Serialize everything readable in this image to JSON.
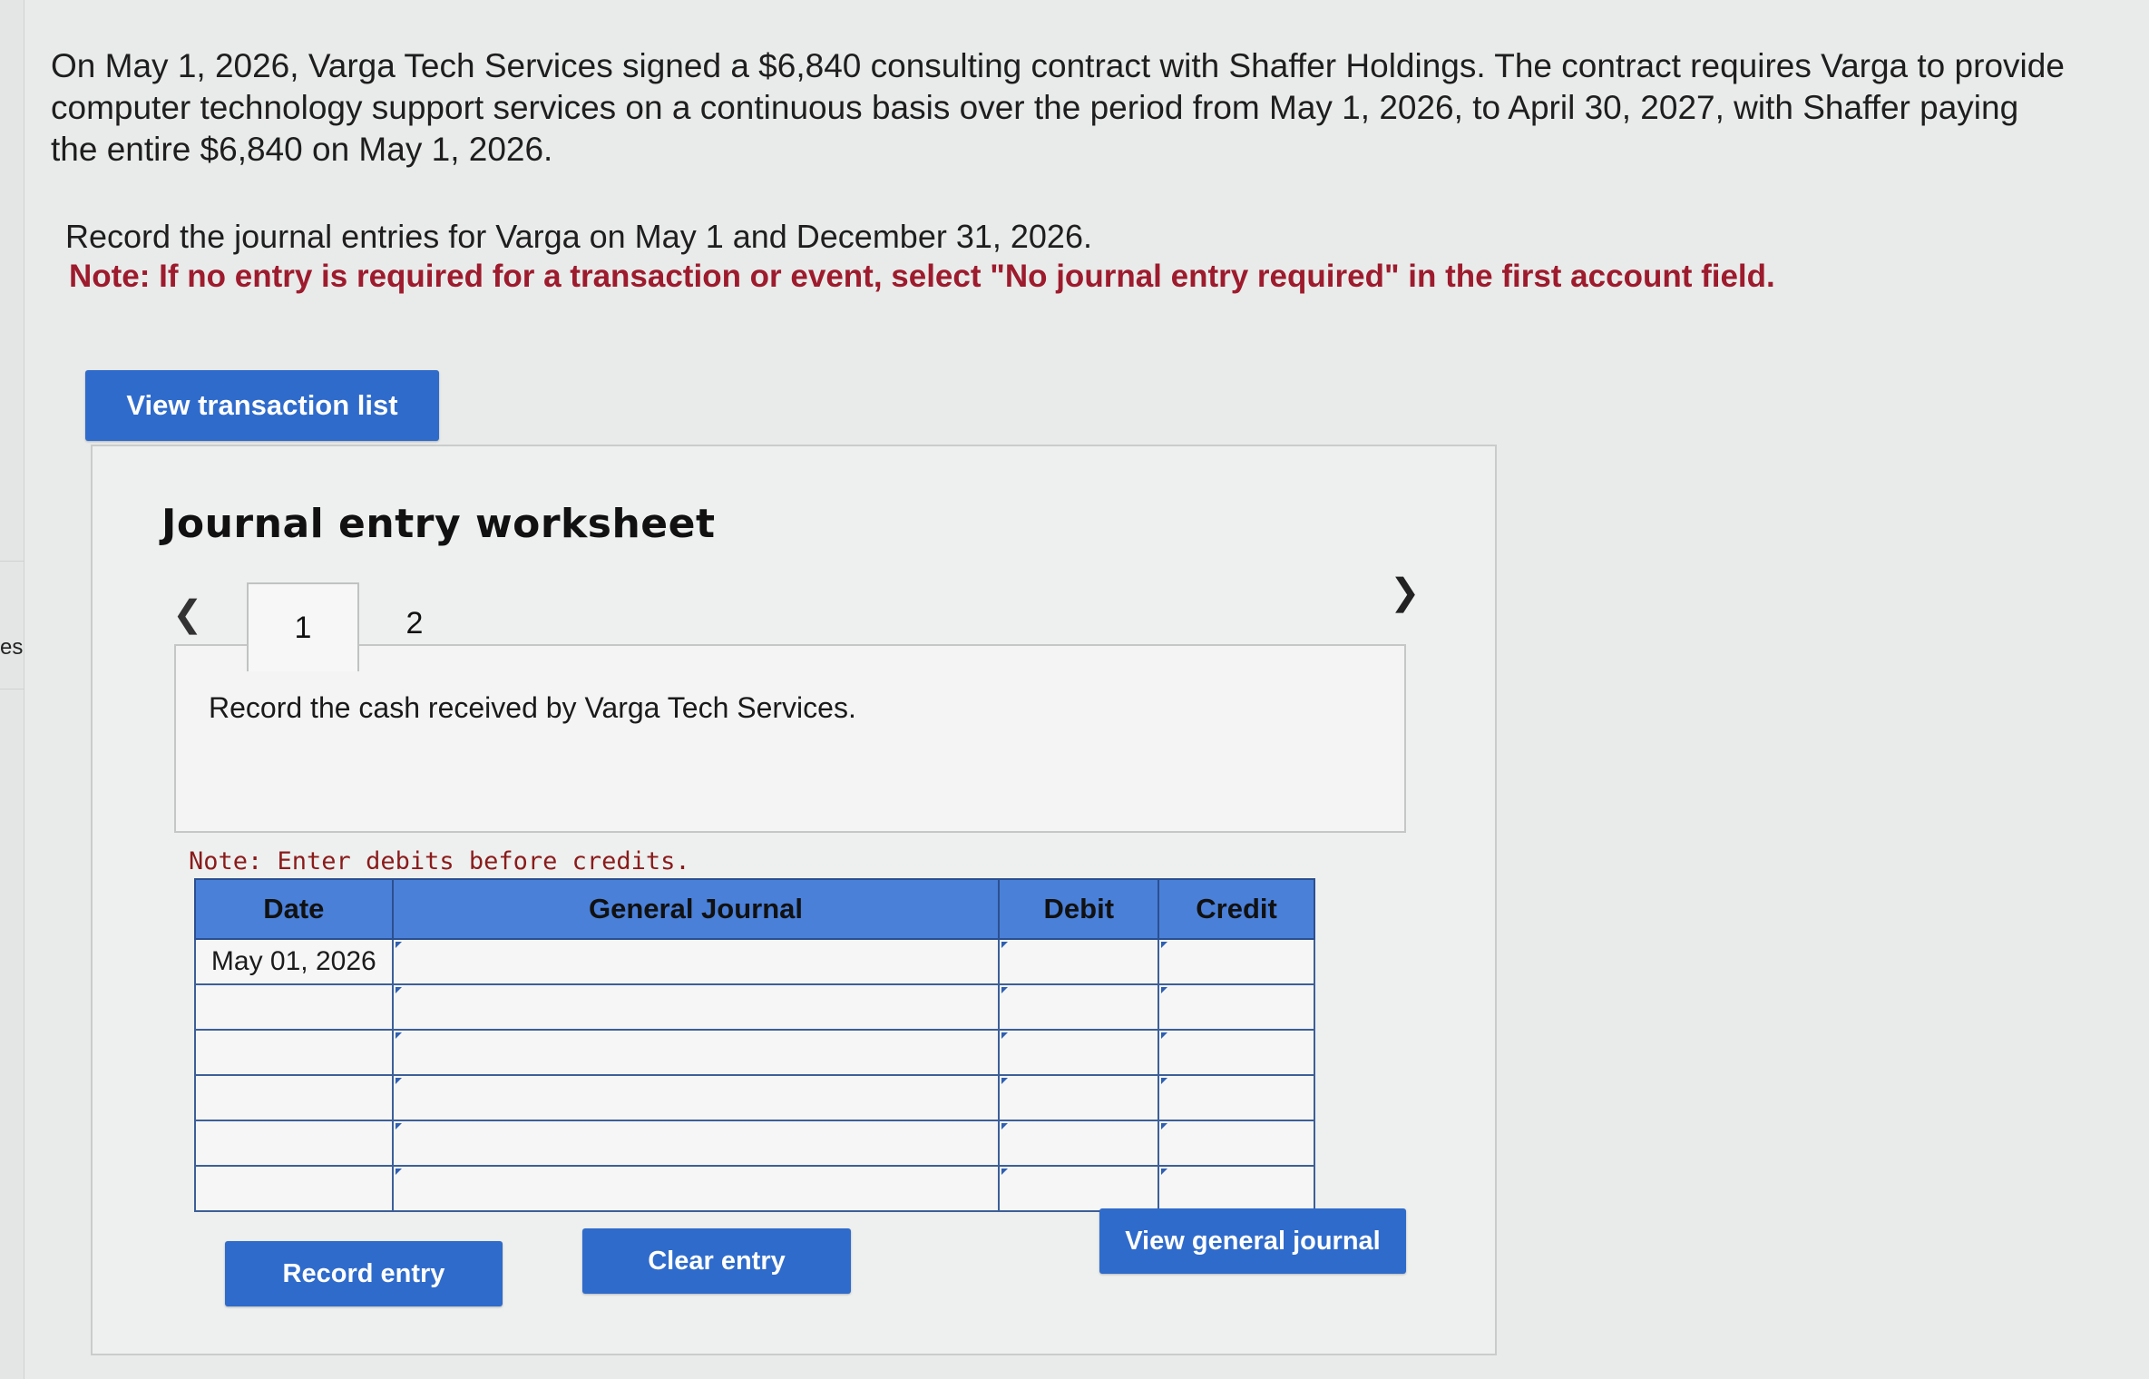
{
  "problem": {
    "intro": "On May 1, 2026, Varga Tech Services signed a $6,840 consulting contract with Shaffer Holdings. The contract requires Varga to provide computer technology support services on a continuous basis over the period from May 1, 2026, to April 30, 2027, with Shaffer paying the entire $6,840 on May 1, 2026.",
    "instruction": "Record the journal entries for Varga on May 1 and December 31, 2026.",
    "note": "Note: If no entry is required for a transaction or event, select \"No journal entry required\" in the first account field."
  },
  "left_rail": {
    "fragment": "es"
  },
  "buttons": {
    "view_transaction_list": "View transaction list",
    "record_entry": "Record entry",
    "clear_entry": "Clear entry",
    "view_general_journal": "View general journal"
  },
  "worksheet": {
    "title": "Journal entry worksheet",
    "tabs": [
      {
        "label": "1",
        "active": true
      },
      {
        "label": "2",
        "active": false
      }
    ],
    "prompt": "Record the cash received by Varga Tech Services.",
    "note": "Note: Enter debits before credits.",
    "columns": {
      "date": "Date",
      "general_journal": "General Journal",
      "debit": "Debit",
      "credit": "Credit"
    },
    "rows": [
      {
        "date": "May 01, 2026",
        "account": "",
        "debit": "",
        "credit": ""
      },
      {
        "date": "",
        "account": "",
        "debit": "",
        "credit": ""
      },
      {
        "date": "",
        "account": "",
        "debit": "",
        "credit": ""
      },
      {
        "date": "",
        "account": "",
        "debit": "",
        "credit": ""
      },
      {
        "date": "",
        "account": "",
        "debit": "",
        "credit": ""
      },
      {
        "date": "",
        "account": "",
        "debit": "",
        "credit": ""
      }
    ]
  },
  "icons": {
    "prev": "chevron-left-icon",
    "next": "chevron-right-icon"
  },
  "colors": {
    "button_blue": "#2f6bcb",
    "header_blue": "#4a80d8",
    "note_red": "#9d1b2d"
  }
}
